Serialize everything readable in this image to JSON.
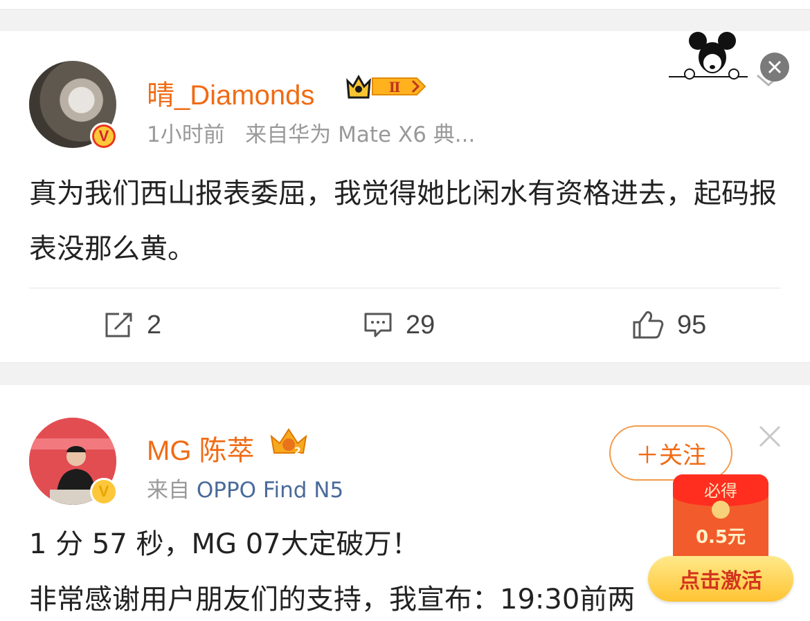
{
  "post1": {
    "username": "晴_Diamonds",
    "vip_level": "Ⅱ",
    "time": "1小时前",
    "source": "来自华为 Mate X6 典...",
    "text": "真为我们西山报表委屈，我觉得她比闲水有资格进去，起码报表没那么黄。",
    "actions": {
      "repost": "2",
      "comment": "29",
      "like": "95"
    }
  },
  "post2": {
    "username": "MG 陈萃",
    "source_prefix": "来自",
    "source_device": "OPPO Find N5",
    "follow_label": "＋关注",
    "text_line1": "1 分 57 秒，MG 07大定破万！",
    "text_line2": "非常感谢用户朋友们的支持，我宣布：19:30前两"
  },
  "redpacket": {
    "top_label": "必得",
    "amount": "0.5元",
    "button_label": "点击激活"
  },
  "colors": {
    "username": "#f06b14",
    "meta": "#999999",
    "device_link": "#4a6a9a",
    "follow_border": "#f39a4a"
  },
  "icons": [
    "repost-icon",
    "comment-icon",
    "like-icon",
    "chevron-down-icon",
    "close-icon",
    "verified-badge-icon",
    "vip-crown-icon",
    "mickey-sticker-icon"
  ]
}
